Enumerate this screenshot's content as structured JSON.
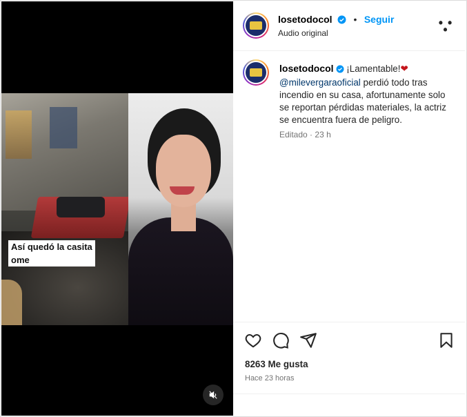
{
  "post": {
    "username": "losetodocol",
    "follow_label": "Seguir",
    "audio_label": "Audio original",
    "video_caption_line1": "Así quedó la casita",
    "video_caption_line2": "ome"
  },
  "comment": {
    "username": "losetodocol",
    "lead": "¡Lamentable!",
    "mention": "@milevergaraoficial",
    "body": " perdió todo tras incendio en su casa, afortunamente solo se reportan pérdidas materiales, la actriz se encuentra fuera de peligro.",
    "edited_label": "Editado",
    "age": "23 h"
  },
  "engagement": {
    "likes_label": "8263 Me gusta",
    "posted_ago": "Hace 23 horas"
  },
  "icons": [
    "verified-icon",
    "more-options-icon",
    "heart-icon",
    "comment-icon",
    "share-icon",
    "bookmark-icon",
    "mute-icon"
  ],
  "colors": {
    "accent": "#0095f6",
    "verified": "#0095f6",
    "mention": "#00376b",
    "muted_text": "#737373",
    "red_heart": "#c4161c"
  }
}
